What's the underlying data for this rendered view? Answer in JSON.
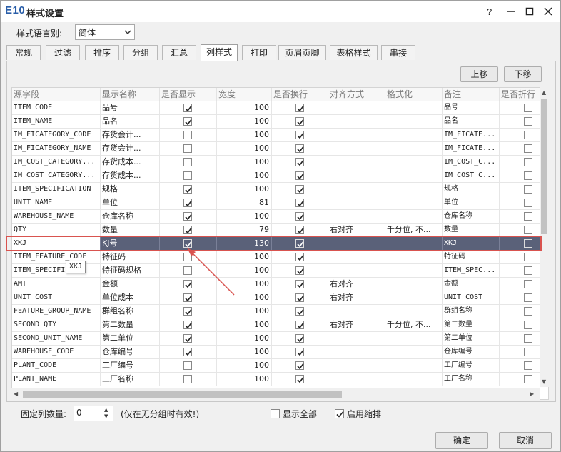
{
  "window": {
    "app_logo": "E10",
    "title": "样式设置"
  },
  "language": {
    "label": "样式语言别:",
    "value": "简体"
  },
  "tabs": [
    {
      "label": "常规"
    },
    {
      "label": "过滤"
    },
    {
      "label": "排序"
    },
    {
      "label": "分组"
    },
    {
      "label": "汇总"
    },
    {
      "label": "列样式"
    },
    {
      "label": "打印"
    },
    {
      "label": "页眉页脚"
    },
    {
      "label": "表格样式"
    },
    {
      "label": "串接"
    }
  ],
  "active_tab": "列样式",
  "toolbar": {
    "up_label": "上移",
    "down_label": "下移"
  },
  "grid": {
    "columns": [
      "源字段",
      "显示名称",
      "是否显示",
      "宽度",
      "是否换行",
      "对齐方式",
      "格式化",
      "备注",
      "是否折行"
    ],
    "rows": [
      {
        "field": "ITEM_CODE",
        "name": "品号",
        "show": true,
        "width": "100",
        "wrap": true,
        "align": "",
        "format": "",
        "note": "品号",
        "fold": false
      },
      {
        "field": "ITEM_NAME",
        "name": "品名",
        "show": true,
        "width": "100",
        "wrap": true,
        "align": "",
        "format": "",
        "note": "品名",
        "fold": false
      },
      {
        "field": "IM_FICATEGORY_CODE",
        "name": "存货会计...",
        "show": false,
        "width": "100",
        "wrap": true,
        "align": "",
        "format": "",
        "note": "IM_FICATE...",
        "fold": false
      },
      {
        "field": "IM_FICATEGORY_NAME",
        "name": "存货会计...",
        "show": false,
        "width": "100",
        "wrap": true,
        "align": "",
        "format": "",
        "note": "IM_FICATE...",
        "fold": false
      },
      {
        "field": "IM_COST_CATEGORY...",
        "name": "存货成本...",
        "show": false,
        "width": "100",
        "wrap": true,
        "align": "",
        "format": "",
        "note": "IM_COST_C...",
        "fold": false
      },
      {
        "field": "IM_COST_CATEGORY...",
        "name": "存货成本...",
        "show": false,
        "width": "100",
        "wrap": true,
        "align": "",
        "format": "",
        "note": "IM_COST_C...",
        "fold": false
      },
      {
        "field": "ITEM_SPECIFICATION",
        "name": "规格",
        "show": true,
        "width": "100",
        "wrap": true,
        "align": "",
        "format": "",
        "note": "规格",
        "fold": false
      },
      {
        "field": "UNIT_NAME",
        "name": "单位",
        "show": true,
        "width": "81",
        "wrap": true,
        "align": "",
        "format": "",
        "note": "单位",
        "fold": false
      },
      {
        "field": "WAREHOUSE_NAME",
        "name": "仓库名称",
        "show": true,
        "width": "100",
        "wrap": true,
        "align": "",
        "format": "",
        "note": "仓库名称",
        "fold": false
      },
      {
        "field": "QTY",
        "name": "数量",
        "show": true,
        "width": "79",
        "wrap": true,
        "align": "右对齐",
        "format": "千分位, 不...",
        "note": "数量",
        "fold": false
      },
      {
        "field": "XKJ",
        "name": "KJ号",
        "show": true,
        "width": "130",
        "wrap": true,
        "align": "",
        "format": "",
        "note": "XKJ",
        "fold": false,
        "selected": true
      },
      {
        "field": "ITEM_FEATURE_CODE",
        "name": "特征码",
        "show": false,
        "width": "100",
        "wrap": true,
        "align": "",
        "format": "",
        "note": "特征码",
        "fold": false
      },
      {
        "field": "ITEM_SPECIFI...N2",
        "name": "特征码规格",
        "show": false,
        "width": "100",
        "wrap": true,
        "align": "",
        "format": "",
        "note": "ITEM_SPEC...",
        "fold": false
      },
      {
        "field": "AMT",
        "name": "金额",
        "show": true,
        "width": "100",
        "wrap": true,
        "align": "右对齐",
        "format": "",
        "note": "金额",
        "fold": false
      },
      {
        "field": "UNIT_COST",
        "name": "单位成本",
        "show": true,
        "width": "100",
        "wrap": true,
        "align": "右对齐",
        "format": "",
        "note": "UNIT_COST",
        "fold": false
      },
      {
        "field": "FEATURE_GROUP_NAME",
        "name": "群组名称",
        "show": true,
        "width": "100",
        "wrap": true,
        "align": "",
        "format": "",
        "note": "群组名称",
        "fold": false
      },
      {
        "field": "SECOND_QTY",
        "name": "第二数量",
        "show": true,
        "width": "100",
        "wrap": true,
        "align": "右对齐",
        "format": "千分位, 不...",
        "note": "第二数量",
        "fold": false
      },
      {
        "field": "SECOND_UNIT_NAME",
        "name": "第二单位",
        "show": true,
        "width": "100",
        "wrap": true,
        "align": "",
        "format": "",
        "note": "第二单位",
        "fold": false
      },
      {
        "field": "WAREHOUSE_CODE",
        "name": "仓库编号",
        "show": true,
        "width": "100",
        "wrap": true,
        "align": "",
        "format": "",
        "note": "仓库编号",
        "fold": false
      },
      {
        "field": "PLANT_CODE",
        "name": "工厂编号",
        "show": false,
        "width": "100",
        "wrap": true,
        "align": "",
        "format": "",
        "note": "工厂编号",
        "fold": false
      },
      {
        "field": "PLANT_NAME",
        "name": "工厂名称",
        "show": false,
        "width": "100",
        "wrap": true,
        "align": "",
        "format": "",
        "note": "工厂名称",
        "fold": false
      }
    ]
  },
  "tooltip": "XKJ",
  "footer": {
    "fixed_cols_label": "固定列数量:",
    "fixed_cols_value": "0",
    "hint": "(仅在无分组时有效!)",
    "show_all_label": "显示全部",
    "show_all_checked": false,
    "indent_label": "启用缩排",
    "indent_checked": true,
    "ok_label": "确定",
    "cancel_label": "取消"
  },
  "colors": {
    "selected_row": "#5a6179",
    "highlight_outline": "#d9534f",
    "arrow": "#d9534f",
    "logo": "#2a5ea8"
  }
}
